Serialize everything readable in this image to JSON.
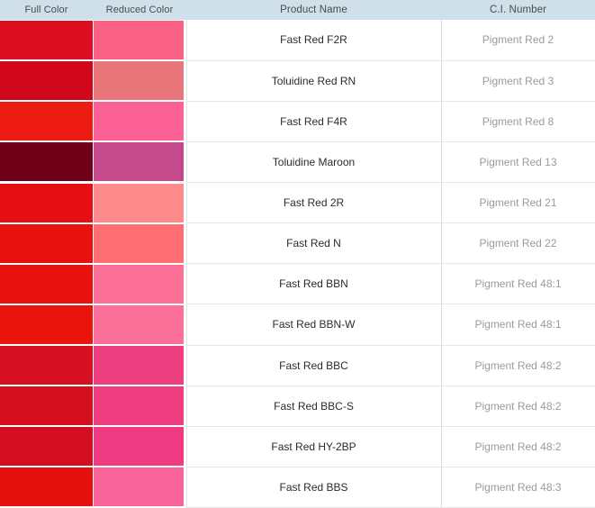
{
  "table": {
    "name": "pigment-reference-table",
    "columns": [
      {
        "key": "full_color",
        "label": "Full Color"
      },
      {
        "key": "reduced_color",
        "label": "Reduced Color"
      },
      {
        "key": "product_name",
        "label": "Product Name"
      },
      {
        "key": "ci_number",
        "label": "C.I. Number"
      }
    ],
    "header_background": "#cfe0ea",
    "header_text_color": "#4a4a4a",
    "product_text_color": "#2b2b2b",
    "ci_text_color": "#9a9a9a",
    "rows": [
      {
        "full_color": "#dd0d22",
        "reduced_color": "#fa6285",
        "product_name": "Fast Red F2R",
        "ci_number": "Pigment Red 2"
      },
      {
        "full_color": "#d1081c",
        "reduced_color": "#e9767b",
        "product_name": "Toluidine Red RN",
        "ci_number": "Pigment Red 3"
      },
      {
        "full_color": "#ec1c12",
        "reduced_color": "#fb6195",
        "product_name": "Fast Red F4R",
        "ci_number": "Pigment Red 8"
      },
      {
        "full_color": "#6e0018",
        "reduced_color": "#c44a8c",
        "product_name": "Toluidine Maroon",
        "ci_number": "Pigment Red 13"
      },
      {
        "full_color": "#e60f14",
        "reduced_color": "#fd8b8b",
        "product_name": "Fast Red 2R",
        "ci_number": "Pigment Red 21"
      },
      {
        "full_color": "#e81110",
        "reduced_color": "#fd6f73",
        "product_name": "Fast Red N",
        "ci_number": "Pigment Red 22"
      },
      {
        "full_color": "#e8120f",
        "reduced_color": "#fc6f97",
        "product_name": "Fast Red BBN",
        "ci_number": "Pigment Red 48:1"
      },
      {
        "full_color": "#ea140c",
        "reduced_color": "#fb7099",
        "product_name": "Fast Red BBN-W",
        "ci_number": "Pigment Red 48:1"
      },
      {
        "full_color": "#d70f22",
        "reduced_color": "#ee3f81",
        "product_name": "Fast Red BBC",
        "ci_number": "Pigment Red 48:2"
      },
      {
        "full_color": "#d60f1f",
        "reduced_color": "#ef3e80",
        "product_name": "Fast Red BBC-S",
        "ci_number": "Pigment Red 48:2"
      },
      {
        "full_color": "#d30e20",
        "reduced_color": "#ee3b81",
        "product_name": "Fast Red HY-2BP",
        "ci_number": "Pigment Red 48:2"
      },
      {
        "full_color": "#e5110f",
        "reduced_color": "#f86499",
        "product_name": "Fast Red BBS",
        "ci_number": "Pigment Red 48:3"
      }
    ]
  }
}
